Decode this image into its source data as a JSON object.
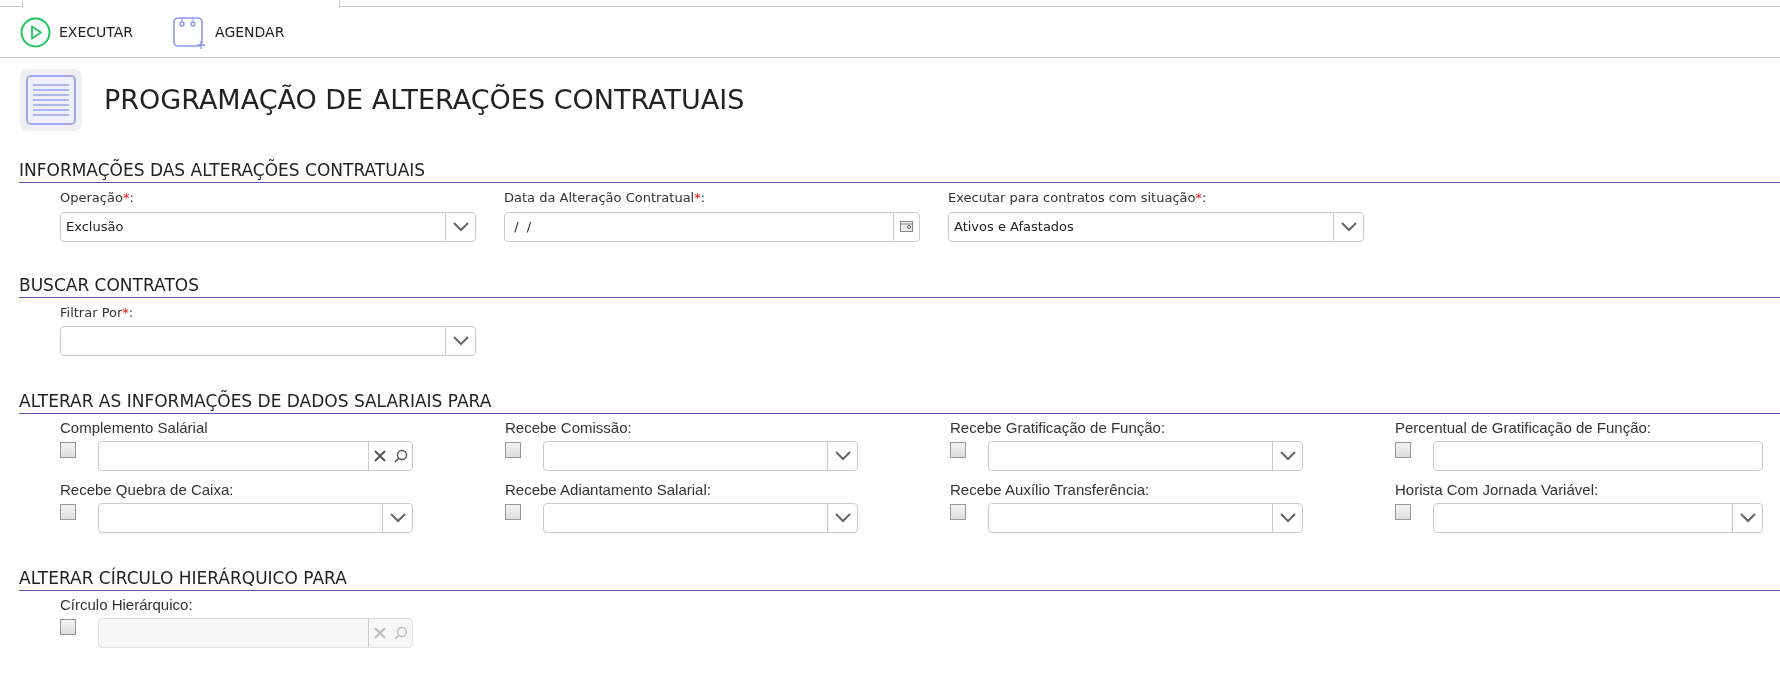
{
  "toolbar": [
    {
      "kind": "run",
      "label": "EXECUTAR"
    },
    {
      "kind": "schedule",
      "label": "AGENDAR"
    }
  ],
  "page_title": "PROGRAMAÇÃO DE ALTERAÇÕES CONTRATUAIS",
  "sections": [
    {
      "title": "INFORMAÇÕES DAS ALTERAÇÕES CONTRATUAIS",
      "fields": [
        {
          "label": "Operação",
          "required_mark": "*",
          "label_end": ":",
          "kind": "select",
          "value": "Exclusão"
        },
        {
          "label": "Data da Alteração Contratual",
          "required_mark": "*",
          "label_end": ":",
          "kind": "date",
          "value": " /  /"
        },
        {
          "label": "Executar para contratos com situação",
          "required_mark": "*",
          "label_end": ":",
          "kind": "select",
          "value": "Ativos e Afastados"
        }
      ]
    },
    {
      "title": "BUSCAR CONTRATOS",
      "fields": [
        {
          "label": "Filtrar Por",
          "required_mark": "*",
          "label_end": ":",
          "kind": "select"
        }
      ]
    },
    {
      "title": "ALTERAR AS INFORMAÇÕES DE DADOS SALARIAIS PARA",
      "fields": [
        {
          "label": "Complemento Salárial",
          "kind": "lookup",
          "checked": false,
          "disabled": false
        },
        {
          "label": "Recebe Comissão:",
          "kind": "select",
          "checked": false,
          "disabled": false
        },
        {
          "label": "Recebe Gratificação de Função:",
          "kind": "select",
          "checked": false,
          "disabled": false
        },
        {
          "label": "Percentual de Gratificação de Função:",
          "kind": "text",
          "checked": false,
          "disabled": false
        },
        {
          "label": "Recebe Quebra de Caixa:",
          "kind": "select",
          "checked": false,
          "disabled": false
        },
        {
          "label": "Recebe Adiantamento Salarial:",
          "kind": "select",
          "checked": false,
          "disabled": false
        },
        {
          "label": "Recebe Auxílio Transferência:",
          "kind": "select",
          "checked": false,
          "disabled": false
        },
        {
          "label": "Horista Com Jornada Variável:",
          "kind": "select",
          "checked": false,
          "disabled": false
        }
      ]
    },
    {
      "title": "ALTERAR CÍRCULO HIERÁRQUICO PARA",
      "fields": [
        {
          "label": "Círculo Hierárquico:",
          "kind": "lookup",
          "checked": false,
          "disabled": true
        }
      ]
    }
  ]
}
